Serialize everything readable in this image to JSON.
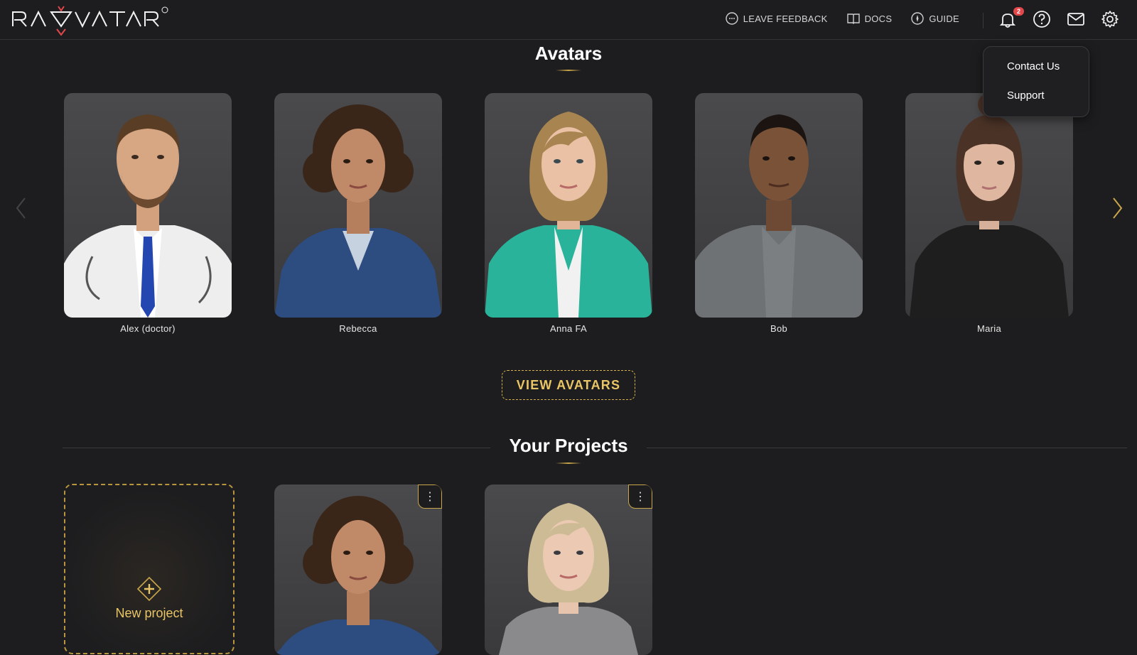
{
  "app": {
    "brand": "RAVATAR",
    "brand_mark": "®"
  },
  "nav": {
    "feedback": "LEAVE FEEDBACK",
    "docs": "DOCS",
    "guide": "GUIDE",
    "notification_count": "2"
  },
  "dropdown": {
    "items": [
      "Contact Us",
      "Support"
    ]
  },
  "avatars_section": {
    "title": "Avatars",
    "items": [
      {
        "name": "Alex (doctor)"
      },
      {
        "name": "Rebecca"
      },
      {
        "name": "Anna FA"
      },
      {
        "name": "Bob"
      },
      {
        "name": "Maria"
      }
    ],
    "view_button": "VIEW AVATARS"
  },
  "projects_section": {
    "title": "Your Projects",
    "new_project": "New project",
    "menu_icon": "⋮"
  },
  "colors": {
    "accent": "#e9c565",
    "background": "#1d1d1f",
    "badge": "#e4474a"
  }
}
